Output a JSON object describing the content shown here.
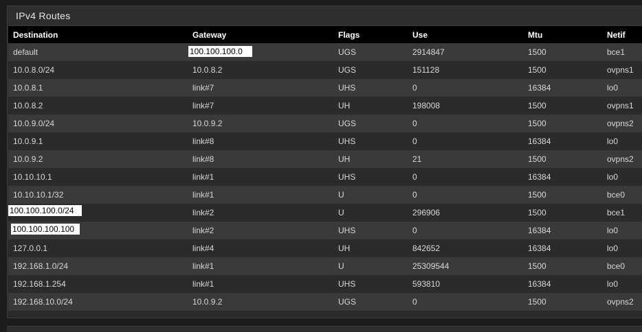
{
  "panel": {
    "title": "IPv4 Routes"
  },
  "table": {
    "headers": [
      "Destination",
      "Gateway",
      "Flags",
      "Use",
      "Mtu",
      "Netif"
    ],
    "rows": [
      [
        "default",
        "100.100.100.0",
        "UGS",
        "2914847",
        "1500",
        "bce1"
      ],
      [
        "10.0.8.0/24",
        "10.0.8.2",
        "UGS",
        "151128",
        "1500",
        "ovpns1"
      ],
      [
        "10.0.8.1",
        "link#7",
        "UHS",
        "0",
        "16384",
        "lo0"
      ],
      [
        "10.0.8.2",
        "link#7",
        "UH",
        "198008",
        "1500",
        "ovpns1"
      ],
      [
        "10.0.9.0/24",
        "10.0.9.2",
        "UGS",
        "0",
        "1500",
        "ovpns2"
      ],
      [
        "10.0.9.1",
        "link#8",
        "UHS",
        "0",
        "16384",
        "lo0"
      ],
      [
        "10.0.9.2",
        "link#8",
        "UH",
        "21",
        "1500",
        "ovpns2"
      ],
      [
        "10.10.10.1",
        "link#1",
        "UHS",
        "0",
        "16384",
        "lo0"
      ],
      [
        "10.10.10.1/32",
        "link#1",
        "U",
        "0",
        "1500",
        "bce0"
      ],
      [
        "100.100.100.0/24",
        "link#2",
        "U",
        "296906",
        "1500",
        "bce1"
      ],
      [
        "100.100.100.100",
        "link#2",
        "UHS",
        "0",
        "16384",
        "lo0"
      ],
      [
        "127.0.0.1",
        "link#4",
        "UH",
        "842652",
        "16384",
        "lo0"
      ],
      [
        "192.168.1.0/24",
        "link#1",
        "U",
        "25309544",
        "1500",
        "bce0"
      ],
      [
        "192.168.1.254",
        "link#1",
        "UHS",
        "593810",
        "16384",
        "lo0"
      ],
      [
        "192.168.10.0/24",
        "10.0.9.2",
        "UGS",
        "0",
        "1500",
        "ovpns2"
      ]
    ]
  },
  "colors": {
    "background": "#1c1c1c",
    "panel": "#2a2a2a",
    "header_row": "#000000",
    "row_odd": "#3a3a3a",
    "row_even": "#2b2b2b",
    "text": "#d8d8d8"
  }
}
